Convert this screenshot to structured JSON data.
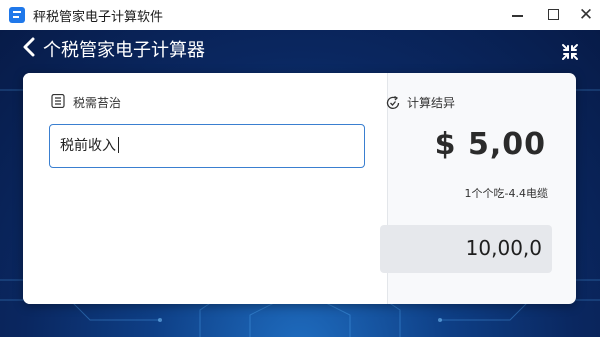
{
  "window": {
    "title": "秤税管家电子计算软件",
    "controls": {
      "minimize": "minimize",
      "maximize": "maximize",
      "close": "✕"
    }
  },
  "header": {
    "title": "个税管家电子计算器",
    "back_icon": "chevron-left-icon",
    "collapse_icon": "collapse-arrows-icon"
  },
  "input_panel": {
    "label": "税需苔治",
    "icon": "calculator-icon",
    "field_value": "税前收入"
  },
  "result_panel": {
    "label": "计算结异",
    "icon": "refresh-check-icon",
    "amount": "$ 5,00",
    "note": "1个个吃-4.4电缆",
    "total": "10,00,0"
  },
  "colors": {
    "accent": "#3a7fd0",
    "header_bg": "#0a2760",
    "card_bg": "#ffffff",
    "total_bg": "#e6e8ec"
  }
}
